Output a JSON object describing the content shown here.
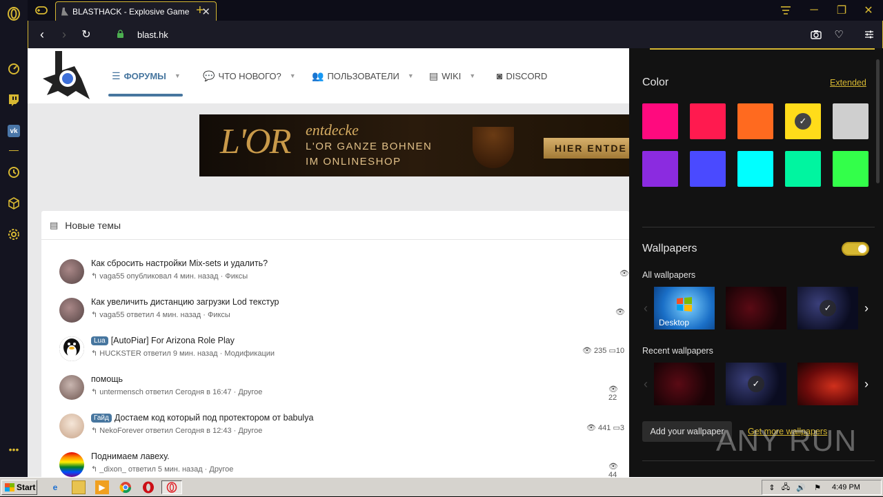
{
  "browser": {
    "tab_title": "BLASTHACK - Explosive Game",
    "url": "blast.hk"
  },
  "site": {
    "nav": [
      {
        "label": "ФОРУМЫ",
        "active": true
      },
      {
        "label": "ЧТО НОВОГО?"
      },
      {
        "label": "ПОЛЬЗОВАТЕЛИ"
      },
      {
        "label": "WIKI"
      },
      {
        "label": "DISCORD"
      }
    ],
    "banner": {
      "brand": "L'OR",
      "line1": "entdecke",
      "line2": "L'OR GANZE BOHNEN",
      "line3": "IM ONLINESHOP",
      "cta": "HIER ENTDE"
    },
    "panel_title": "Новые темы",
    "threads": [
      {
        "title": "Как сбросить настройки Mix-sets и удалить?",
        "meta": "vaga55 опубликовал 4 мин. назад · Фиксы",
        "badge": "",
        "views": "",
        "replies": ""
      },
      {
        "title": "Как увеличить дистанцию загрузки Lod текстур",
        "meta": "vaga55 ответил 4 мин. назад · Фиксы",
        "badge": "",
        "views": "",
        "replies": ""
      },
      {
        "title": "[AutoPiar] For Arizona Role Play",
        "meta": "HUCKSTER ответил 9 мин. назад · Модификации",
        "badge": "Lua",
        "views": "235",
        "replies": "10"
      },
      {
        "title": "помощь",
        "meta": "untermensch ответил Сегодня в 16:47 · Другое",
        "badge": "",
        "views": "22",
        "replies": ""
      },
      {
        "title": "Достаем код который под протектором от babulya",
        "meta": "NekoForever ответил Сегодня в 12:43 · Другое",
        "badge": "Гайд",
        "views": "441",
        "replies": "3"
      },
      {
        "title": "Поднимаем лавеху.",
        "meta": "_dixon_ ответил 5 мин. назад · Другое",
        "badge": "",
        "views": "44",
        "replies": ""
      }
    ]
  },
  "customize": {
    "color_title": "Color",
    "extended_link": "Extended",
    "swatches": [
      "#ff0a7e",
      "#ff1a4f",
      "#ff6a1f",
      "#ffdc1a",
      "#cfcfcf",
      "#8b2be0",
      "#4a4aff",
      "#00ffff",
      "#00f5a0",
      "#33ff4a"
    ],
    "selected_swatch": 3,
    "wallpapers_title": "Wallpapers",
    "all_wallpapers": "All wallpapers",
    "recent_wallpapers": "Recent wallpapers",
    "desktop_label": "Desktop",
    "add_wallpaper": "Add your wallpaper",
    "get_more": "Get more wallpapers",
    "watermark": "ANY RUN"
  },
  "taskbar": {
    "start": "Start",
    "clock": "4:49 PM"
  }
}
